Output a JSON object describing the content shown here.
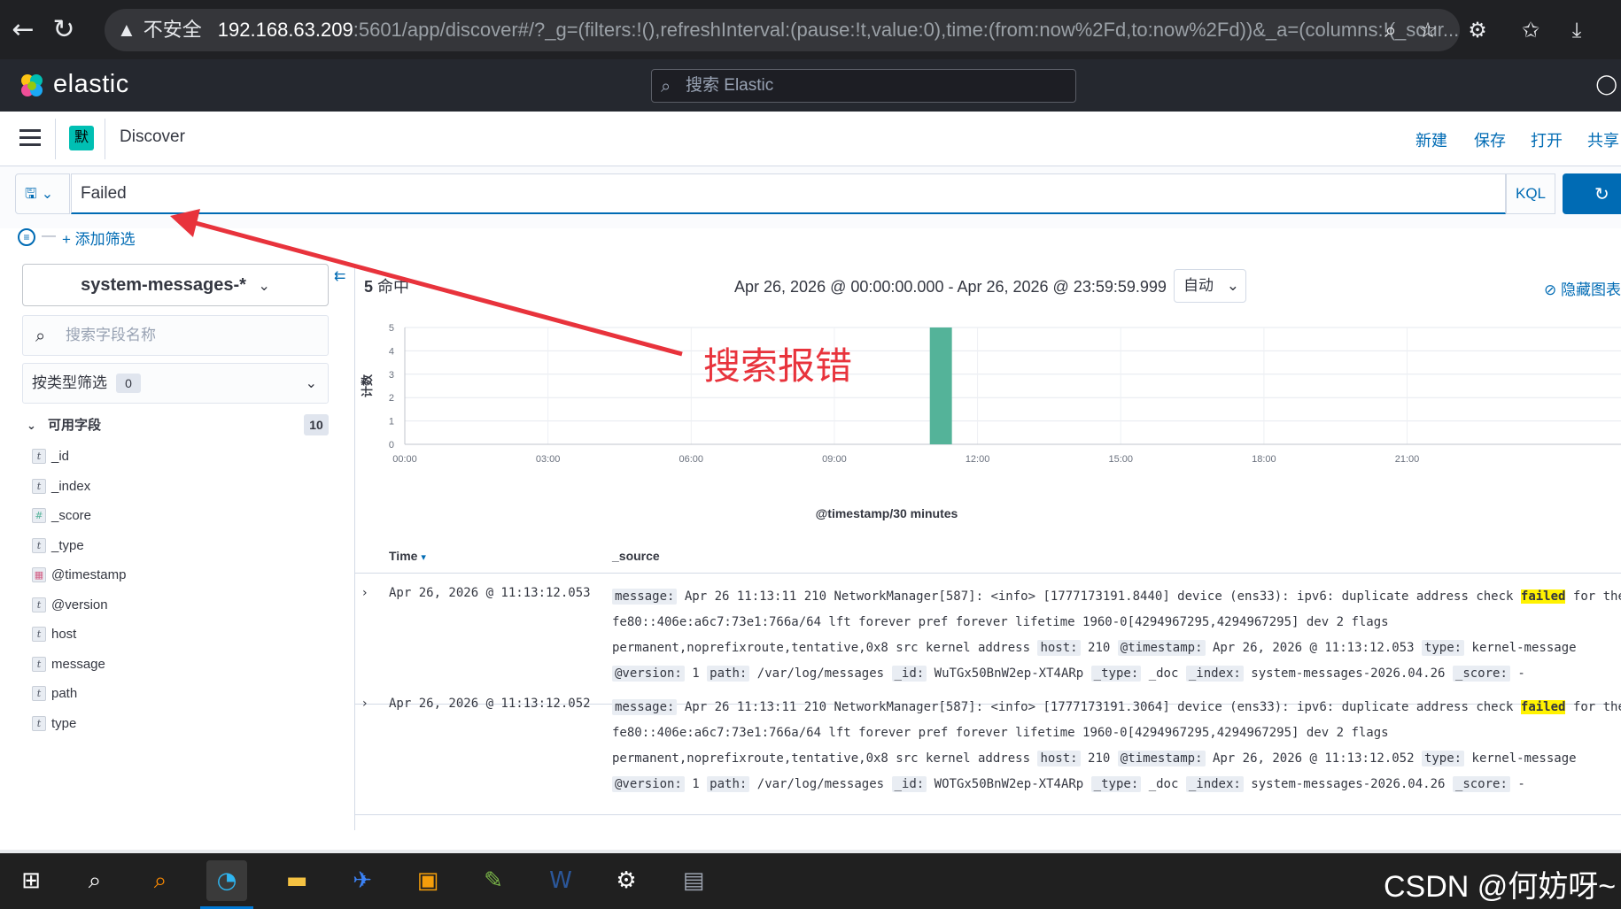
{
  "browser": {
    "warning": "▲",
    "insecure_label": "不安全",
    "url_host": "192.168.63.209",
    "url_rest": ":5601/app/discover#/?_g=(filters:!(),refreshInterval:(pause:!t,value:0),time:(from:now%2Fd,to:now%2Fd))&_a=(columns:!(_sour..."
  },
  "kibana": {
    "brand": "elastic",
    "search_placeholder": "搜索 Elastic"
  },
  "topbar": {
    "space_initial": "默",
    "app_title": "Discover",
    "links": [
      "新建",
      "保存",
      "打开",
      "共享"
    ]
  },
  "query": {
    "value": "Failed",
    "language": "KQL",
    "add_filter": "+ 添加筛选"
  },
  "sidebar": {
    "index_pattern": "system-messages-*",
    "field_search_placeholder": "搜索字段名称",
    "type_filter_label": "按类型筛选",
    "type_filter_count": "0",
    "available_label": "可用字段",
    "available_count": "10",
    "fields": [
      {
        "type": "t",
        "name": "_id"
      },
      {
        "type": "t",
        "name": "_index"
      },
      {
        "type": "#",
        "name": "_score"
      },
      {
        "type": "t",
        "name": "_type"
      },
      {
        "type": "date",
        "name": "@timestamp"
      },
      {
        "type": "t",
        "name": "@version"
      },
      {
        "type": "t",
        "name": "host"
      },
      {
        "type": "t",
        "name": "message"
      },
      {
        "type": "t",
        "name": "path"
      },
      {
        "type": "t",
        "name": "type"
      }
    ]
  },
  "results": {
    "hit_count": "5",
    "hit_label": "命中",
    "time_range": "Apr 26, 2026 @ 00:00:00.000 - Apr 26, 2026 @ 23:59:59.999",
    "interval": "自动",
    "hide_chart": "隐藏图表"
  },
  "chart_data": {
    "type": "bar",
    "ylabel": "计数",
    "xlabel": "@timestamp/30 minutes",
    "x_ticks": [
      "00:00",
      "03:00",
      "06:00",
      "09:00",
      "12:00",
      "15:00",
      "18:00",
      "21:00"
    ],
    "y_ticks": [
      "0",
      "1",
      "2",
      "3",
      "4",
      "5"
    ],
    "ylim": [
      0,
      5
    ],
    "x_range_hours": [
      0,
      24
    ],
    "bars": [
      {
        "start": "11:00",
        "end": "11:30",
        "value": 5
      }
    ],
    "color": "#54b399"
  },
  "table": {
    "col_time": "Time",
    "col_source": "_source",
    "rows": [
      {
        "time": "Apr 26, 2026 @ 11:13:12.053",
        "line1_pre": "Apr 26 11:13:11 210 NetworkManager[587]: <info>  [1777173191.8440] device (ens33): ipv6: duplicate address check ",
        "line1_hl": "failed",
        "line1_post": " for the",
        "line2": "fe80::406e:a6c7:73e1:766a/64 lft forever pref forever lifetime 1960-0[4294967295,4294967295] dev 2 flags",
        "line3": "permanent,noprefixroute,tentative,0x8 src kernel address",
        "host": "210",
        "timestamp": "Apr 26, 2026 @ 11:13:12.053",
        "type": "kernel-message",
        "version": "1",
        "path": "/var/log/messages",
        "id": "WuTGx50BnW2ep-XT4ARp",
        "doc_type": "_doc",
        "index": "system-messages-2026.04.26",
        "score": "-"
      },
      {
        "time": "Apr 26, 2026 @ 11:13:12.052",
        "line1_pre": "Apr 26 11:13:11 210 NetworkManager[587]: <info>  [1777173191.3064] device (ens33): ipv6: duplicate address check ",
        "line1_hl": "failed",
        "line1_post": " for the",
        "line2": "fe80::406e:a6c7:73e1:766a/64 lft forever pref forever lifetime 1960-0[4294967295,4294967295] dev 2 flags",
        "line3": "permanent,noprefixroute,tentative,0x8 src kernel address",
        "host": "210",
        "timestamp": "Apr 26, 2026 @ 11:13:12.052",
        "type": "kernel-message",
        "version": "1",
        "path": "/var/log/messages",
        "id": "WOTGx50BnW2ep-XT4ARp",
        "doc_type": "_doc",
        "index": "system-messages-2026.04.26",
        "score": "-"
      }
    ],
    "labels": {
      "message": "message:",
      "host": "host:",
      "timestamp": "@timestamp:",
      "type": "type:",
      "version": "@version:",
      "path": "path:",
      "id": "_id:",
      "doc_type": "_type:",
      "index": "_index:",
      "score": "_score:"
    }
  },
  "annotation": {
    "text": "搜索报错",
    "color": "#e8333c"
  },
  "watermark": "CSDN @何妨呀~",
  "taskbar_icons": [
    "windows-start-icon",
    "search-icon",
    "everything-search-icon",
    "edge-browser-icon",
    "file-explorer-icon",
    "feishu-icon",
    "screenshot-tool-icon",
    "notepad-icon",
    "word-icon",
    "settings-gear-icon",
    "terminal-icon"
  ]
}
